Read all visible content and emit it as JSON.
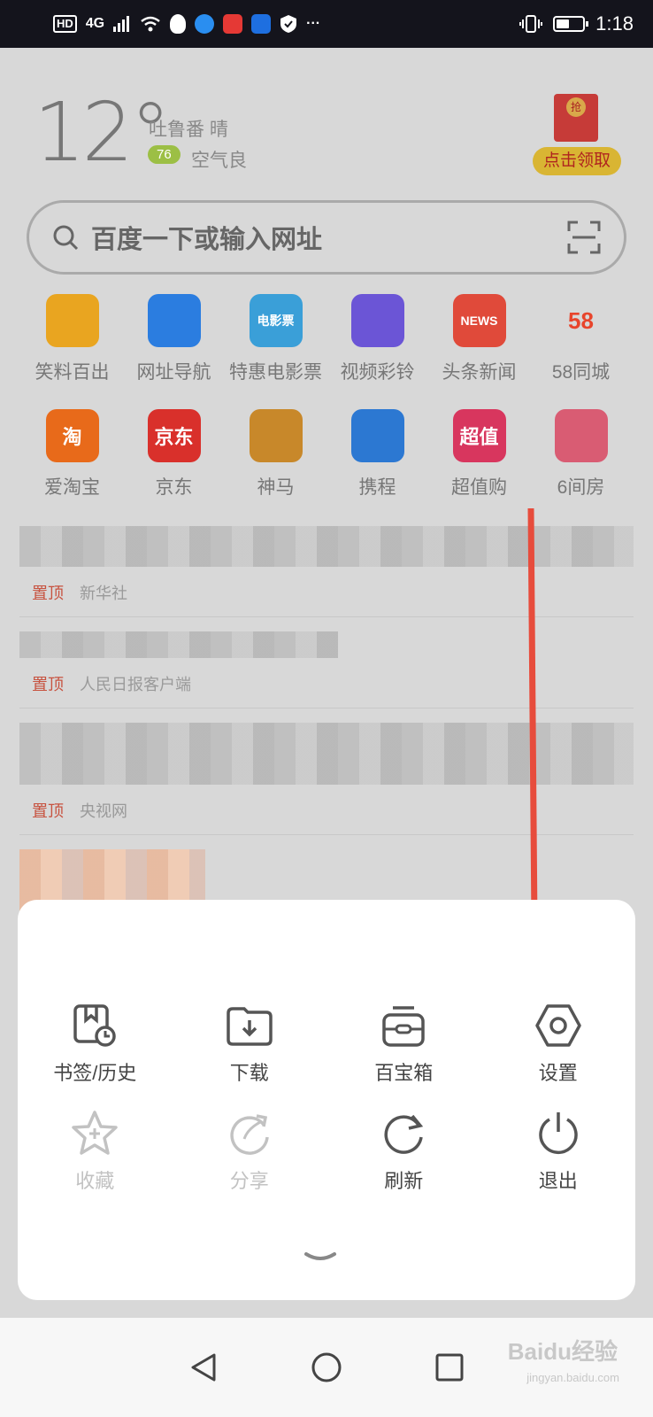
{
  "status_bar": {
    "network": "HD",
    "signal": "4G",
    "time": "1:18",
    "more": "···"
  },
  "weather": {
    "temperature": "12°",
    "city_condition": "吐鲁番  晴",
    "aqi_value": "76",
    "aqi_text": "空气良"
  },
  "promo": {
    "seal": "抢",
    "button": "点击领取"
  },
  "search": {
    "placeholder": "百度一下或输入网址"
  },
  "apps": [
    {
      "label": "笑料百出",
      "icon": "laugh-face-icon",
      "color": "#e9a520"
    },
    {
      "label": "网址导航",
      "icon": "compass-icon",
      "color": "#2b7de0"
    },
    {
      "label": "特惠电影票",
      "icon": "movie-ticket-icon",
      "color": "#3a9fd8",
      "glyph": "电影票"
    },
    {
      "label": "视频彩铃",
      "icon": "video-ringtone-icon",
      "color": "#6b55d6"
    },
    {
      "label": "头条新闻",
      "icon": "news-icon",
      "color": "#e04a3a",
      "glyph": "NEWS"
    },
    {
      "label": "58同城",
      "icon": "58-logo-icon",
      "color": "#d8d8d8",
      "glyph": "58"
    },
    {
      "label": "爱淘宝",
      "icon": "taobao-icon",
      "color": "#e86a1a",
      "glyph": "淘"
    },
    {
      "label": "京东",
      "icon": "jd-icon",
      "color": "#d9302b",
      "glyph": "京东"
    },
    {
      "label": "神马",
      "icon": "alpaca-icon",
      "color": "#c8882a"
    },
    {
      "label": "携程",
      "icon": "dolphin-icon",
      "color": "#2c78d2"
    },
    {
      "label": "超值购",
      "icon": "super-deal-icon",
      "color": "#d8365e",
      "glyph": "超值"
    },
    {
      "label": "6间房",
      "icon": "6rooms-icon",
      "color": "#d95c73"
    }
  ],
  "news": [
    {
      "pin": "置顶",
      "source": "新华社"
    },
    {
      "pin": "置顶",
      "source": "人民日报客户端"
    },
    {
      "pin": "置顶",
      "source": "央视网"
    }
  ],
  "menu": [
    {
      "label": "书签/历史",
      "icon": "bookmark-history-icon",
      "enabled": true
    },
    {
      "label": "下载",
      "icon": "download-folder-icon",
      "enabled": true
    },
    {
      "label": "百宝箱",
      "icon": "toolbox-icon",
      "enabled": true
    },
    {
      "label": "设置",
      "icon": "settings-hexagon-icon",
      "enabled": true
    },
    {
      "label": "收藏",
      "icon": "star-plus-icon",
      "enabled": false
    },
    {
      "label": "分享",
      "icon": "share-icon",
      "enabled": false
    },
    {
      "label": "刷新",
      "icon": "refresh-icon",
      "enabled": true
    },
    {
      "label": "退出",
      "icon": "power-icon",
      "enabled": true
    }
  ],
  "watermark": {
    "main": "Baidu经验",
    "sub": "jingyan.baidu.com"
  },
  "colors": {
    "arrow": "#e74c3c",
    "pin": "#c7523f",
    "aqi_badge": "#9cbf45"
  }
}
